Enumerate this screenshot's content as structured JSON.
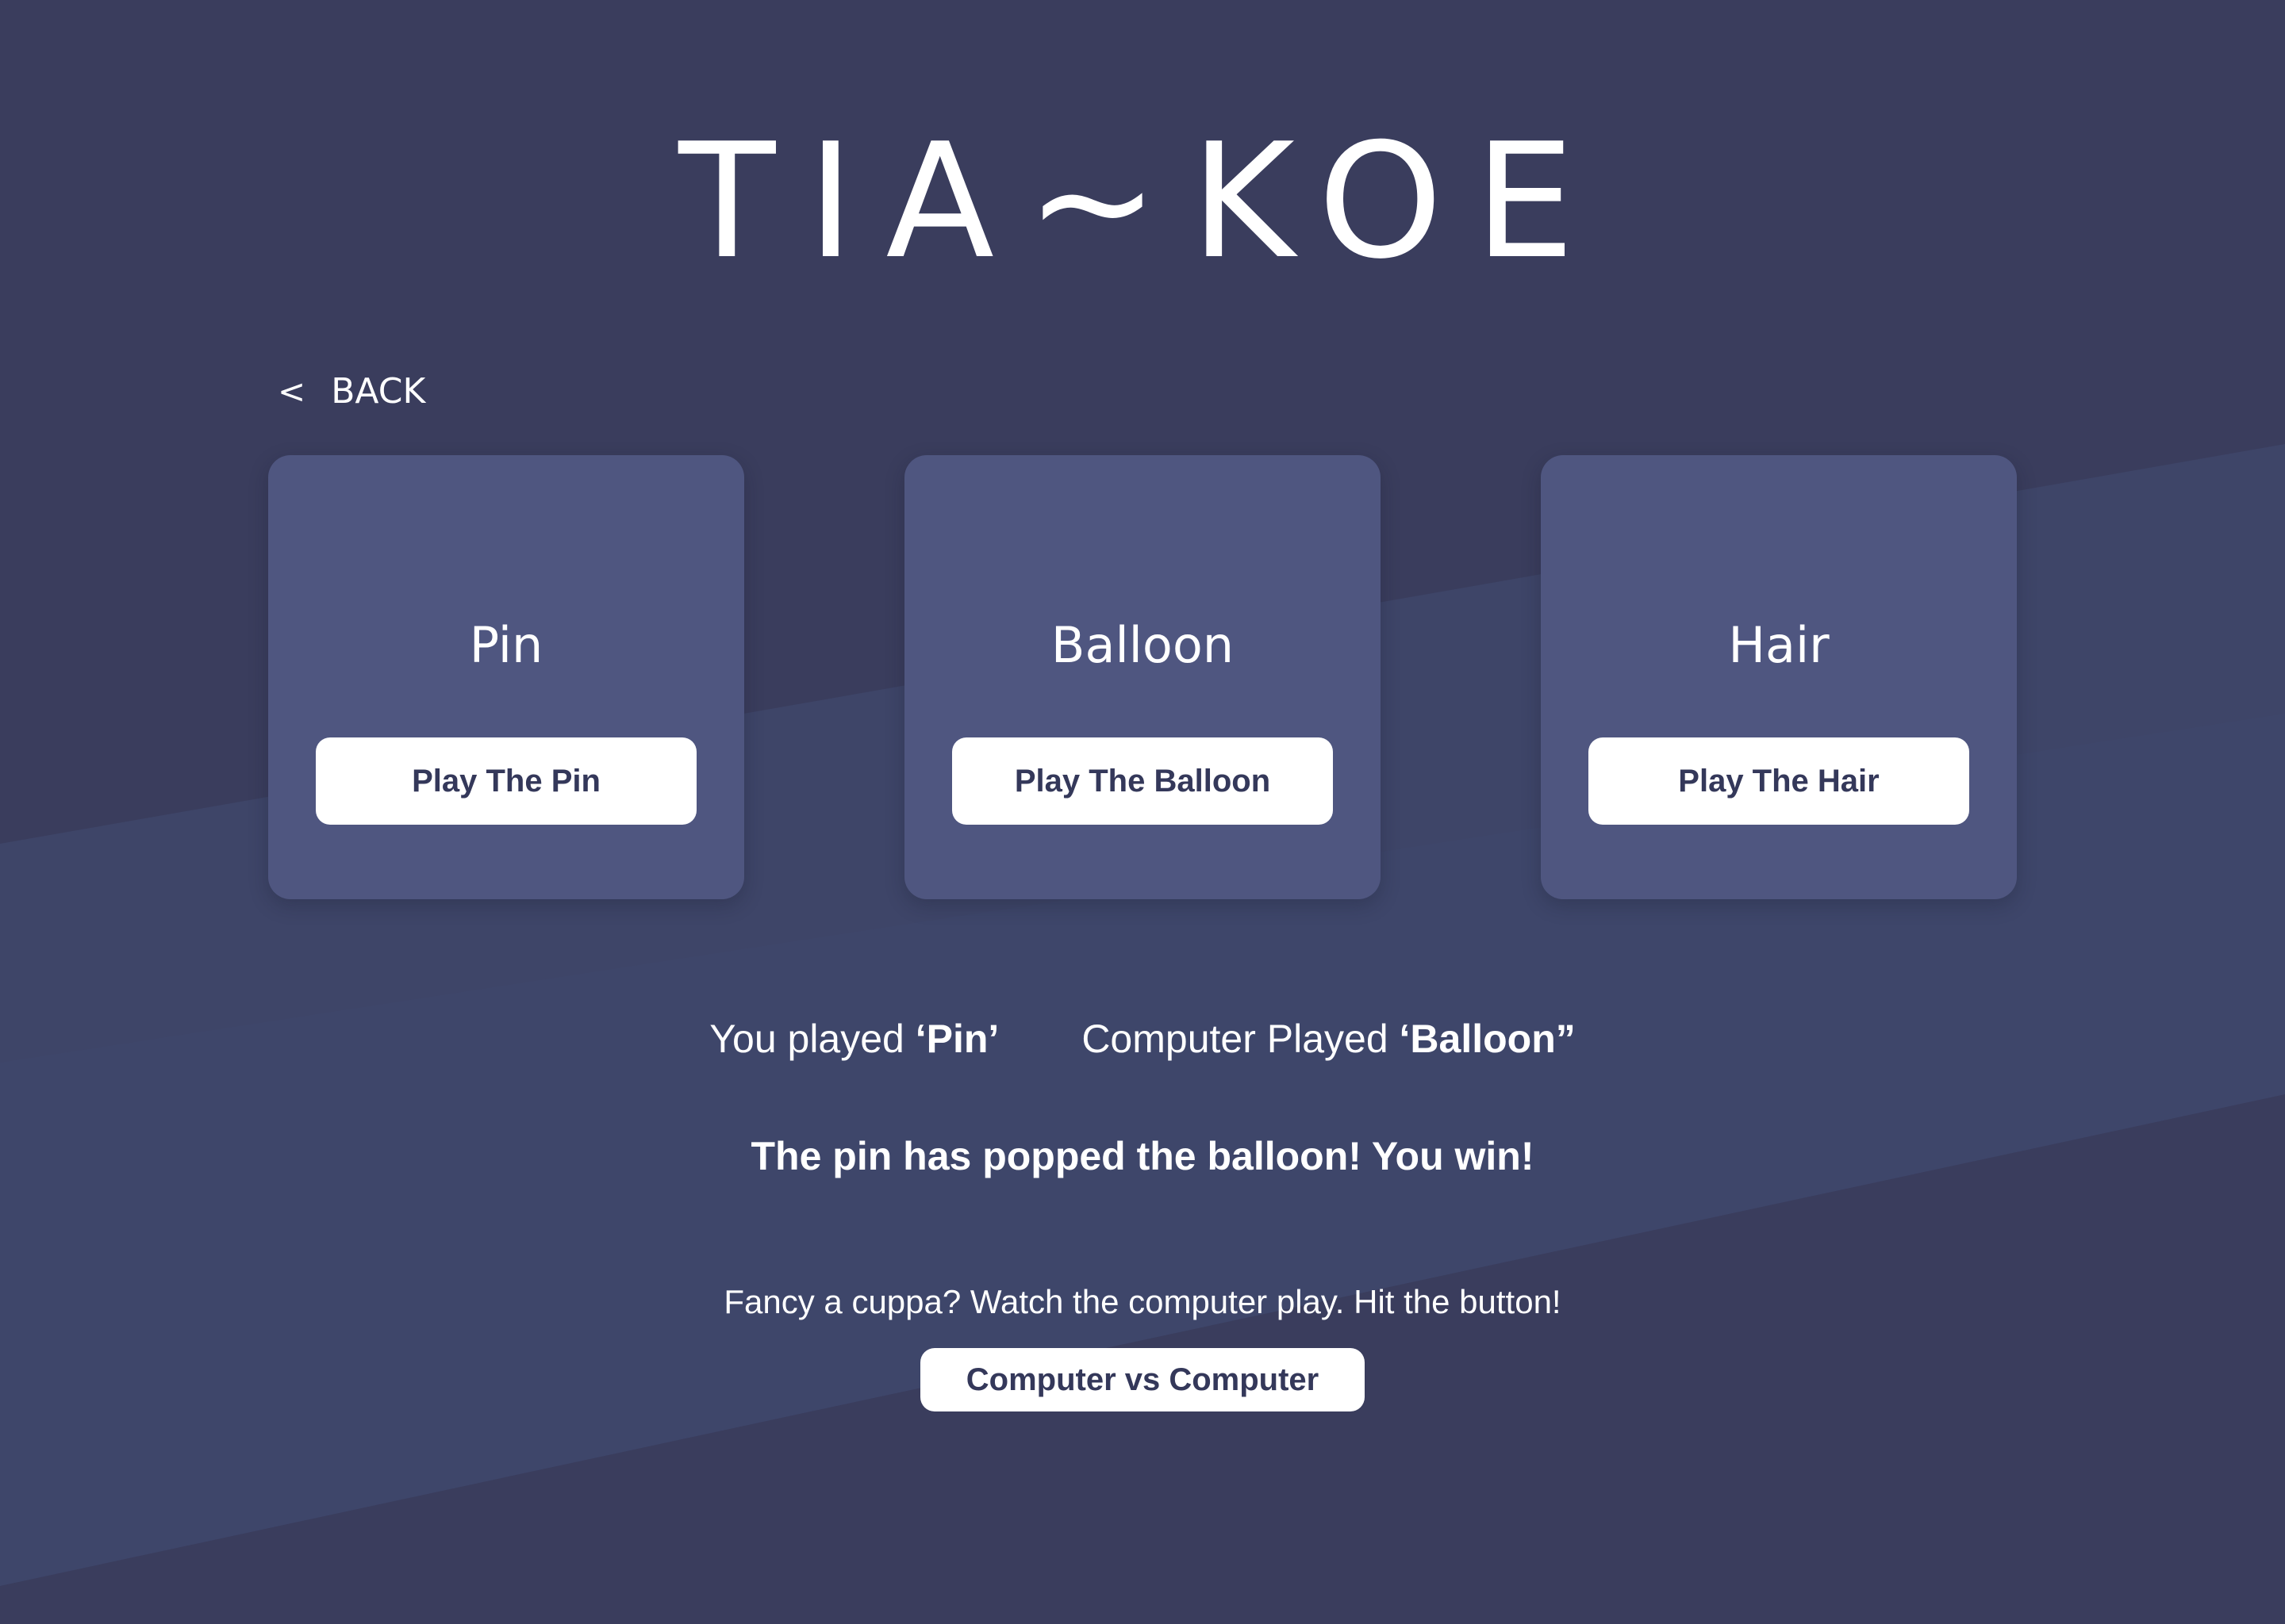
{
  "app": {
    "logo": "TIA~KOE"
  },
  "nav": {
    "back_chevron": "<",
    "back_label": "BACK"
  },
  "cards": [
    {
      "title": "Pin",
      "button": "Play The Pin"
    },
    {
      "title": "Balloon",
      "button": "Play The Balloon"
    },
    {
      "title": "Hair",
      "button": "Play The Hair"
    }
  ],
  "result": {
    "you_played_prefix": "You played ",
    "you_played_value": "‘Pin’",
    "computer_played_prefix": "Computer Played ",
    "computer_played_value": "‘Balloon”",
    "message": "The pin has popped the balloon! You win!"
  },
  "auto_play": {
    "hint": "Fancy a cuppa? Watch the computer play. Hit the button!",
    "button": "Computer vs Computer"
  },
  "colors": {
    "background": "#3a3d5d",
    "card": "#4f5680",
    "button_text": "#34385a"
  }
}
